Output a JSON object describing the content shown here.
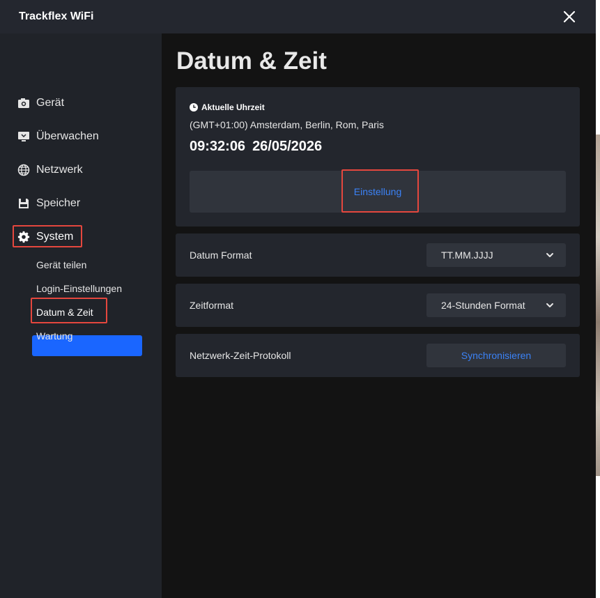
{
  "app": {
    "title": "Trackflex WiFi"
  },
  "sidebar": {
    "items": [
      {
        "label": "Gerät",
        "icon": "camera-icon"
      },
      {
        "label": "Überwachen",
        "icon": "monitor-icon"
      },
      {
        "label": "Netzwerk",
        "icon": "globe-icon"
      },
      {
        "label": "Speicher",
        "icon": "floppy-disk-icon"
      },
      {
        "label": "System",
        "icon": "gear-icon"
      }
    ],
    "sub_items": [
      "Gerät teilen",
      "Login-Einstellungen",
      "Datum & Zeit",
      "Wartung"
    ],
    "active_sub_item": "Datum & Zeit"
  },
  "main": {
    "title": "Datum & Zeit",
    "current_time": {
      "section_title": "Aktuelle Uhrzeit",
      "timezone": "(GMT+01:00) Amsterdam, Berlin, Rom, Paris",
      "time": "09:32:06",
      "date": "26/05/2026",
      "settings_button": "Einstellung"
    },
    "date_format": {
      "label": "Datum Format",
      "value": "TT.MM.JJJJ"
    },
    "time_format": {
      "label": "Zeitformat",
      "value": "24-Stunden Format"
    },
    "ntp": {
      "label": "Netzwerk-Zeit-Protokoll",
      "button": "Synchronisieren"
    }
  },
  "colors": {
    "accent": "#1a66ff",
    "link": "#3b82f6",
    "highlight": "#e5473e",
    "sidebar_bg": "#202329",
    "card_bg": "#23262d",
    "main_bg": "#131313"
  }
}
